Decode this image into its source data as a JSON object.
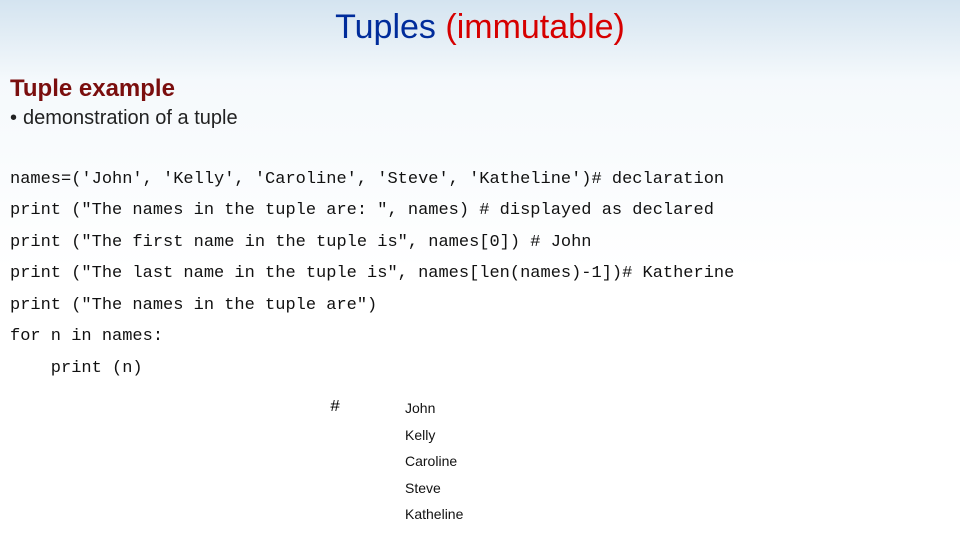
{
  "title": {
    "part1": "Tuples ",
    "part2": "(immutable)"
  },
  "subtitle": "Tuple example",
  "bullet": "demonstration of a tuple",
  "code": {
    "l1": "names=('John', 'Kelly', 'Caroline', 'Steve', 'Katheline')# declaration",
    "l2": "print (\"The names in the tuple are: \", names) # displayed as declared",
    "l3": "print (\"The first name in the tuple is\", names[0]) # John",
    "l4": "print (\"The last name in the tuple is\", names[len(names)-1])# Katherine",
    "l5": "print (\"The names in the tuple are\")",
    "l6": "for n in names:",
    "l7": "    print (n)"
  },
  "hash": "#",
  "output": {
    "o1": "John",
    "o2": "Kelly",
    "o3": "Caroline",
    "o4": "Steve",
    "o5": "Katheline"
  }
}
